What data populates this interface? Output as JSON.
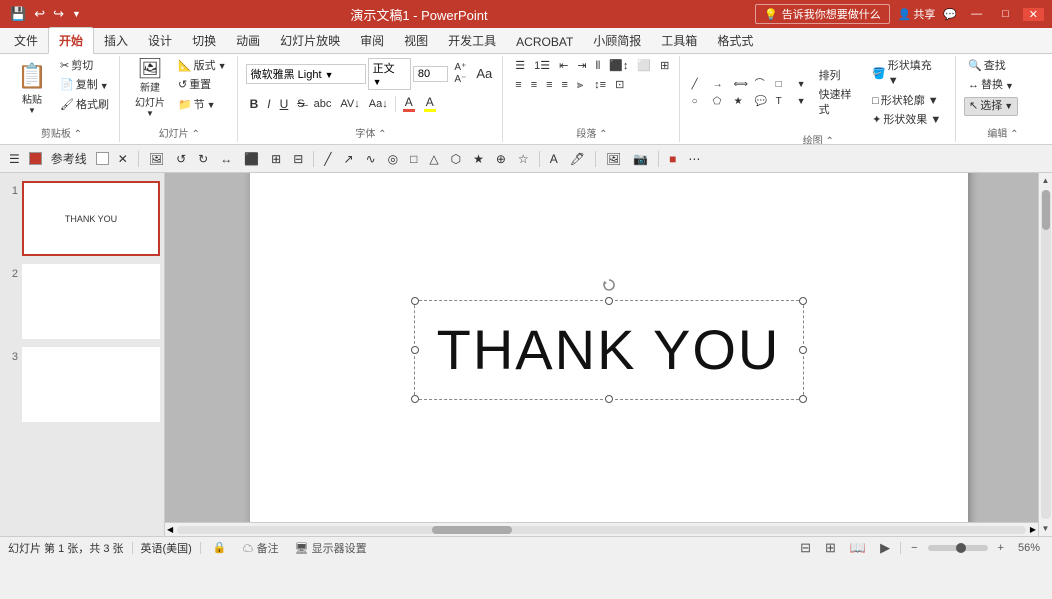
{
  "titlebar": {
    "title": "演示文稿1 - PowerPoint",
    "save_icon": "💾",
    "undo_icon": "↩",
    "redo_icon": "↪",
    "share_label": "共享",
    "help_label": "告诉我你想要做什么",
    "minimize": "—",
    "maximize": "□",
    "close": "✕"
  },
  "quickaccess": {
    "buttons": [
      "💾",
      "↩",
      "↪",
      "▼"
    ]
  },
  "menus": {
    "items": [
      "文件",
      "开始",
      "插入",
      "设计",
      "切换",
      "动画",
      "幻灯片放映",
      "审阅",
      "视图",
      "开发工具",
      "ACROBAT",
      "小顾简报",
      "工具箱",
      "格式式"
    ]
  },
  "ribbon": {
    "active_tab": "开始",
    "tabs": [
      "文件",
      "开始",
      "插入",
      "设计",
      "切换",
      "动画",
      "幻灯片放映",
      "审阅",
      "视图",
      "开发工具",
      "ACROBAT",
      "小顾简报",
      "工具箱",
      "格式式"
    ],
    "clipboard_group": "剪贴板",
    "clipboard_buttons": [
      "粘贴",
      "剪切",
      "复制",
      "格式刷"
    ],
    "slides_group": "幻灯片",
    "slides_buttons": [
      "新建\n幻灯片",
      "版式",
      "重置",
      "节"
    ],
    "font_group": "字体",
    "font_name": "微软雅黑 Light",
    "font_style": "正文",
    "font_size": "80",
    "font_format_buttons": [
      "B",
      "I",
      "U",
      "S",
      "abc",
      "AV↓",
      "Aa↓"
    ],
    "paragraph_group": "段落",
    "drawing_group": "绘图",
    "editing_group": "编辑",
    "find_label": "查找",
    "replace_label": "替换",
    "select_label": "选择",
    "shape_fill_label": "形状填充 ▼",
    "shape_outline_label": "形状轮廓 ▼",
    "shape_effect_label": "形状效果 ▼",
    "arrange_label": "排列",
    "quick_styles_label": "快速样式"
  },
  "toolbar2": {
    "reference_line_label": "参考线",
    "buttons": [
      "⊞",
      "□",
      "↩",
      "↪",
      "⊟",
      "⊕",
      "⊖",
      "▦",
      "▣",
      "↙",
      "↗",
      "⊙",
      "🔲",
      "▽",
      "▷",
      "∿",
      "◎",
      "□",
      "△",
      "⬠",
      "★",
      "⊕",
      "☆",
      "A",
      "🖊"
    ]
  },
  "slides": [
    {
      "num": "1",
      "text": "THANK YOU",
      "active": true
    },
    {
      "num": "2",
      "text": "",
      "active": false
    },
    {
      "num": "3",
      "text": "",
      "active": false
    }
  ],
  "canvas": {
    "text": "THANK YOU"
  },
  "statusbar": {
    "slide_info": "幻灯片 第 1 张，共 3 张",
    "language": "英语(美国)",
    "backup_label": "备注",
    "display_label": "显示器设置",
    "zoom_level": "56%",
    "zoom_value": 56
  }
}
